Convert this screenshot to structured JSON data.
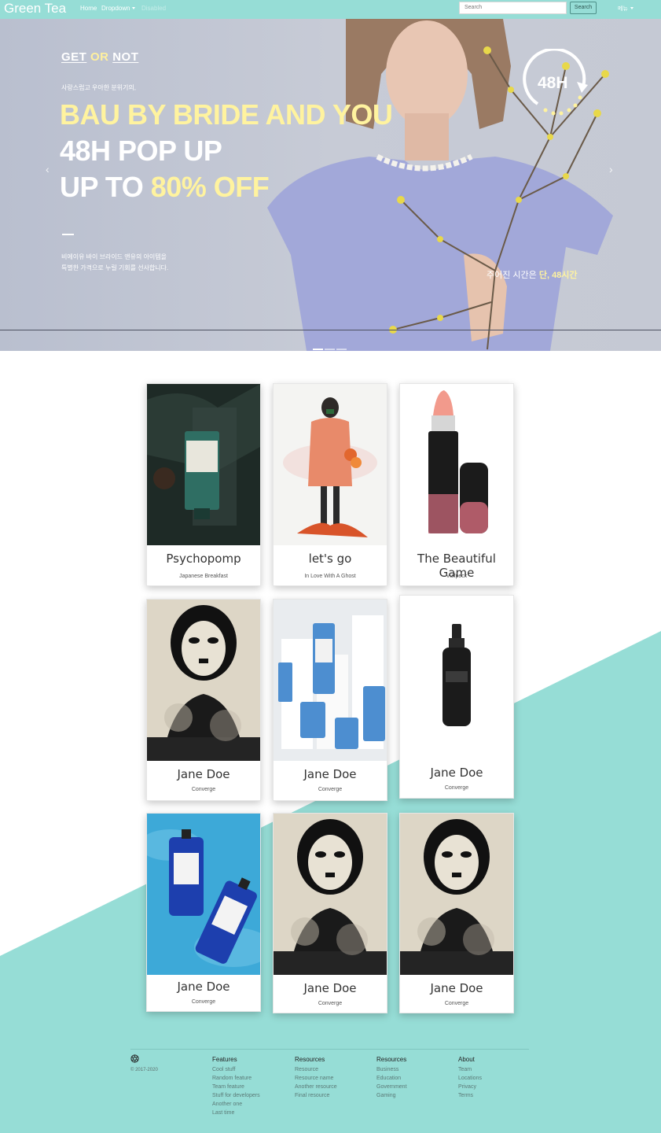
{
  "navbar": {
    "brand": "Green Tea",
    "links": [
      "Home",
      "Dropdown",
      "Disabled"
    ],
    "search_placeholder": "Search",
    "search_button": "Search",
    "menu_label": "메뉴"
  },
  "hero": {
    "eyebrow_get": "GET",
    "eyebrow_or": "OR",
    "eyebrow_not": "NOT",
    "sub": "사랑스럽고 우아한 분위기의,",
    "line1": "BAU BY BRIDE AND YOU",
    "line2": "48H POP UP",
    "line3_a": "UP TO ",
    "line3_b": "80% OFF",
    "desc1": "비에이유 바이 브라이드 앤유의 아이템을",
    "desc2": "특별한 가격으로 누릴 기회를 선사합니다.",
    "badge": "48H",
    "time_note_a": "주어진 시간은 ",
    "time_note_b": "단, 48시간",
    "prev_arrow": "‹",
    "next_arrow": "›"
  },
  "cards": [
    {
      "title": "Psychopomp",
      "subtitle": "Japanese Breakfast",
      "icon": "dark-tube-product"
    },
    {
      "title": "let's go",
      "subtitle": "In Love With A Ghost",
      "icon": "illustrated-girl"
    },
    {
      "title": "The Beautiful Game",
      "subtitle": "Vulfpeck",
      "icon": "lipstick"
    },
    {
      "title": "Jane Doe",
      "subtitle": "Converge",
      "icon": "jane-doe-art"
    },
    {
      "title": "Jane Doe",
      "subtitle": "Converge",
      "icon": "blue-bottles"
    },
    {
      "title": "Jane Doe",
      "subtitle": "Converge",
      "icon": "serum-bottle"
    },
    {
      "title": "Jane Doe",
      "subtitle": "Converge",
      "icon": "water-bottles"
    },
    {
      "title": "Jane Doe",
      "subtitle": "Converge",
      "icon": "jane-doe-art"
    },
    {
      "title": "Jane Doe",
      "subtitle": "Converge",
      "icon": "jane-doe-art"
    }
  ],
  "footer": {
    "copyright": "© 2017-2020",
    "columns": [
      {
        "heading": "Features",
        "links": [
          "Cool stuff",
          "Random feature",
          "Team feature",
          "Stuff for developers",
          "Another one",
          "Last time"
        ]
      },
      {
        "heading": "Resources",
        "links": [
          "Resource",
          "Resource name",
          "Another resource",
          "Final resource"
        ]
      },
      {
        "heading": "Resources",
        "links": [
          "Business",
          "Education",
          "Government",
          "Gaming"
        ]
      },
      {
        "heading": "About",
        "links": [
          "Team",
          "Locations",
          "Privacy",
          "Terms"
        ]
      }
    ]
  },
  "colors": {
    "accent": "#96ddd6",
    "highlight": "#fff39f"
  }
}
